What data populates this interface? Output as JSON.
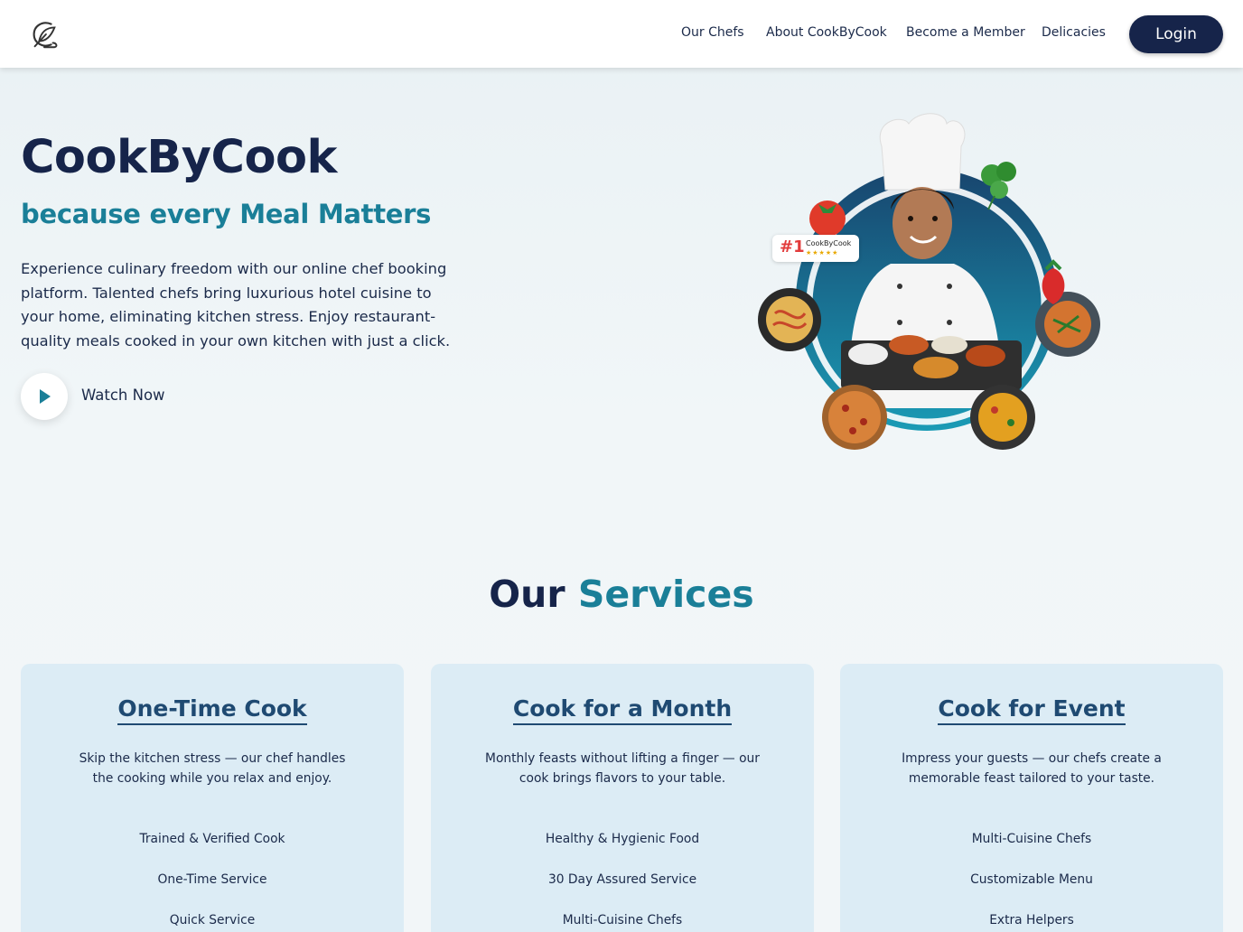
{
  "header": {
    "logo": "fork-leaf-logo-icon",
    "nav": [
      "Our Chefs",
      "About CookByCook",
      "Become a Member",
      "Delicacies"
    ],
    "login_label": "Login"
  },
  "hero": {
    "title": "CookByCook",
    "subtitle": "because every Meal Matters",
    "description": "Experience culinary freedom with our online chef booking platform. Talented chefs bring luxurious hotel cuisine to your home, eliminating kitchen stress. Enjoy restaurant-quality meals cooked in your own kitchen with just a click.",
    "watch_label": "Watch Now",
    "badge": {
      "rank": "#1",
      "name": "CookByCook",
      "stars": "★★★★★"
    }
  },
  "services": {
    "title_part1": "Our",
    "title_part2": "Services",
    "cards": [
      {
        "title": "One-Time Cook",
        "desc_line1": "Skip the kitchen stress — our chef handles",
        "desc_line2": "the cooking while you relax and enjoy.",
        "features": [
          "Trained & Verified Cook",
          "One-Time Service",
          "Quick Service"
        ]
      },
      {
        "title": "Cook for a Month",
        "desc_line1": "Monthly feasts without lifting a finger — our",
        "desc_line2": "cook brings flavors to your table.",
        "features": [
          "Healthy & Hygienic Food",
          "30 Day Assured Service",
          "Multi-Cuisine Chefs"
        ]
      },
      {
        "title": "Cook for Event",
        "desc_line1": "Impress your guests — our chefs create a",
        "desc_line2": "memorable feast tailored to your taste.",
        "features": [
          "Multi-Cuisine Chefs",
          "Customizable Menu",
          "Extra Helpers"
        ]
      }
    ]
  },
  "colors": {
    "navy": "#16244a",
    "teal": "#1a7f98",
    "card_bg": "#dcecf5"
  }
}
